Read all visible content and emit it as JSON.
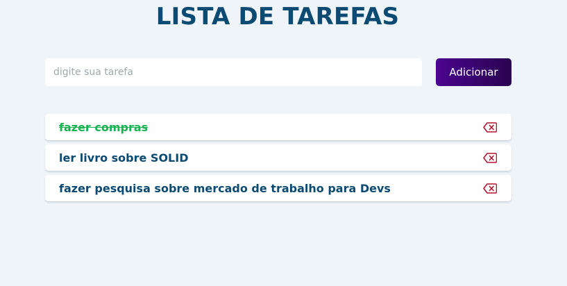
{
  "header": {
    "title": "LISTA DE TAREFAS"
  },
  "form": {
    "input_placeholder": "digite sua tarefa",
    "input_value": "",
    "add_label": "Adicionar"
  },
  "tasks": [
    {
      "label": "fazer compras",
      "done": true,
      "delete_icon": "backspace-icon"
    },
    {
      "label": "ler livro sobre SOLID",
      "done": false,
      "delete_icon": "backspace-icon"
    },
    {
      "label": "fazer pesquisa sobre mercado de trabalho para Devs",
      "done": false,
      "delete_icon": "backspace-icon"
    }
  ],
  "colors": {
    "background": "#eff4f8",
    "title": "#0b4a72",
    "done_task": "#17b350",
    "button_gradient_start": "#4b058f",
    "button_gradient_end": "#2a0350",
    "delete_icon": "#b3122e"
  }
}
